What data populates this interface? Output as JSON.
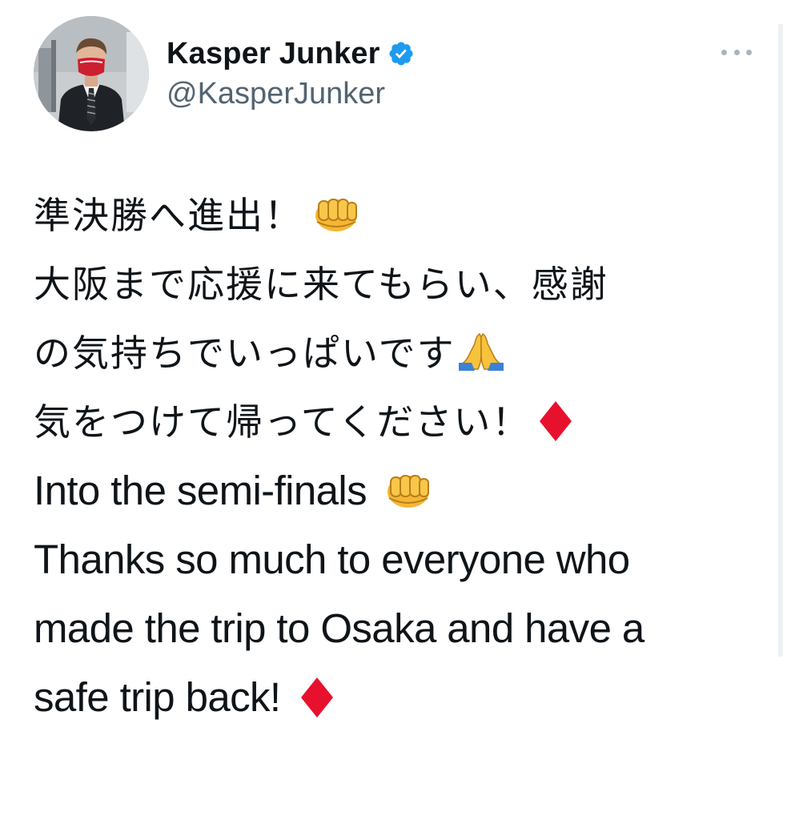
{
  "author": {
    "display_name": "Kasper Junker",
    "handle": "@KasperJunker",
    "verified": true,
    "avatar": "profile-photo",
    "verified_badge_color": "#1d9bf0"
  },
  "menu": {
    "icon": "more-horizontal-icon"
  },
  "tweet": {
    "lines": [
      "準決勝へ進出！",
      "大阪まで応援に来てもらい、感謝",
      "の気持ちでいっぱいです",
      "気をつけて帰ってください！",
      "Into the semi-finals",
      "Thanks so much to everyone who",
      "made the trip to Osaka and have a",
      "safe trip back!"
    ],
    "emojis": {
      "fist": "oncoming-fist-icon",
      "pray": "folded-hands-icon",
      "diamond": "red-diamond-icon"
    }
  },
  "colors": {
    "text": "#0f1419",
    "secondary": "#536471",
    "diamond": "#e8112d"
  }
}
